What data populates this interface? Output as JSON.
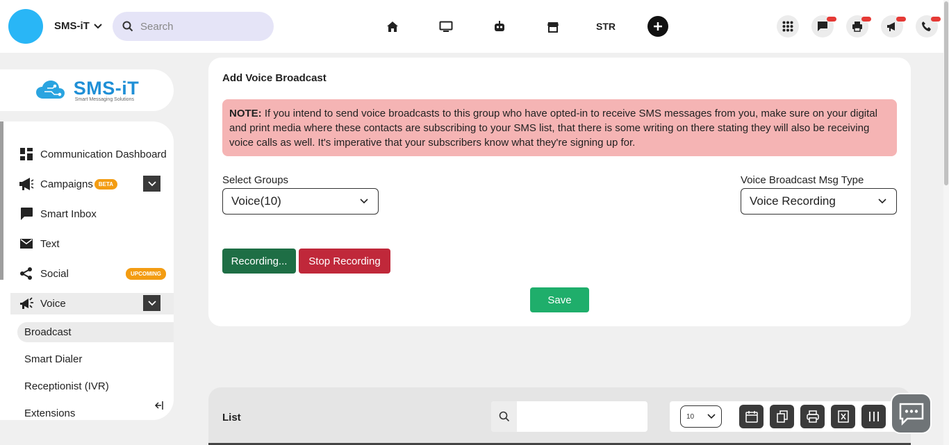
{
  "header": {
    "brand": "SMS-iT",
    "search_placeholder": "Search",
    "nav": [
      "home-icon",
      "monitor-icon",
      "robot-icon",
      "store-icon"
    ],
    "str_label": "STR",
    "right_icons": [
      "apps-grid-icon",
      "chat-icon",
      "printer-icon",
      "megaphone-icon",
      "phone-icon"
    ]
  },
  "logo": {
    "main": "SMS-iT",
    "tagline": "Smart Messaging Solutions"
  },
  "sidebar": {
    "items": [
      {
        "label": "Communication Dashboard",
        "icon": "dashboard-icon"
      },
      {
        "label": "Campaigns",
        "icon": "megaphone-icon",
        "badge": "BETA"
      },
      {
        "label": "Smart Inbox",
        "icon": "chat-bubble-icon"
      },
      {
        "label": "Text",
        "icon": "envelope-icon"
      },
      {
        "label": "Social",
        "icon": "share-icon",
        "badge": "UPCOMING"
      },
      {
        "label": "Voice",
        "icon": "voice-megaphone-icon"
      }
    ],
    "voice_sub": [
      "Broadcast",
      "Smart Dialer",
      "Receptionist (IVR)",
      "Extensions"
    ]
  },
  "main": {
    "title": "Add Voice Broadcast",
    "note_label": "NOTE:",
    "note_text": " If you intend to send voice broadcasts to this group who have opted-in to receive SMS messages from you, make sure on your digital and print media where these contacts are subscribing to your SMS list, that there is some writing on there stating they will also be receiving voice calls as well. It's imperative that your subscribers know what they're signing up for.",
    "groups_label": "Select Groups",
    "groups_value": "Voice(10)",
    "msgtype_label": "Voice Broadcast Msg Type",
    "msgtype_value": "Voice Recording",
    "recording_label": "Recording...",
    "stop_label": "Stop Recording",
    "save_label": "Save"
  },
  "list": {
    "title": "List",
    "page_size": "10"
  },
  "colors": {
    "accent": "#29b6f6",
    "note_bg": "#f5b4b4",
    "recording": "#1e6e45",
    "stop": "#c0283a",
    "save": "#1fae6b",
    "badge": "#f39c12"
  }
}
